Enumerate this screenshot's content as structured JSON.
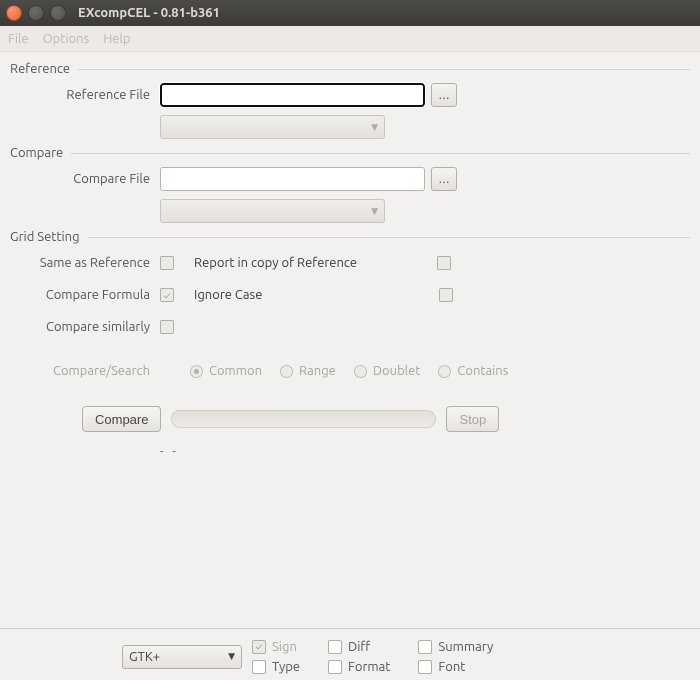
{
  "window": {
    "title": "EXcompCEL - 0.81-b361"
  },
  "menu": {
    "file": "File",
    "options": "Options",
    "help": "Help"
  },
  "sections": {
    "reference": {
      "title": "Reference",
      "file_label": "Reference File",
      "file_value": "",
      "browse": "..."
    },
    "compare": {
      "title": "Compare",
      "file_label": "Compare File",
      "file_value": "",
      "browse": "..."
    },
    "grid": {
      "title": "Grid Setting",
      "same_as_ref": "Same as Reference",
      "report_in_copy": "Report in copy of Reference",
      "compare_formula": "Compare Formula",
      "ignore_case": "Ignore Case",
      "compare_similarly": "Compare similarly",
      "compare_search": "Compare/Search",
      "radios": {
        "common": "Common",
        "range": "Range",
        "doublet": "Doublet",
        "contains": "Contains"
      }
    },
    "actions": {
      "compare_btn": "Compare",
      "stop_btn": "Stop",
      "link_placeholder": "- -"
    }
  },
  "footer": {
    "theme": "GTK+",
    "opts": {
      "sign": "Sign",
      "diff": "Diff",
      "summary": "Summary",
      "type": "Type",
      "format": "Format",
      "font": "Font"
    }
  }
}
